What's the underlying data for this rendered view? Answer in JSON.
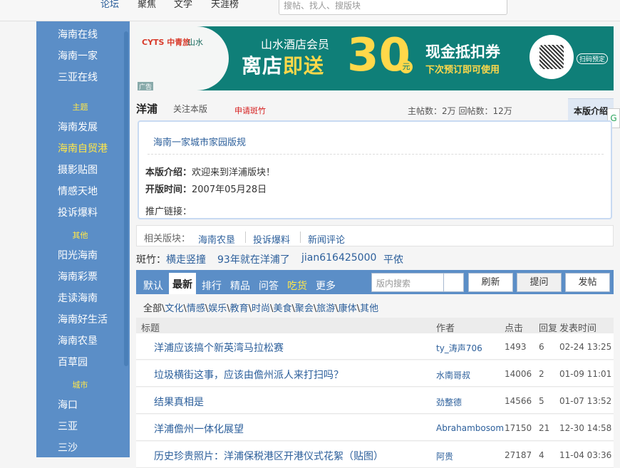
{
  "topnav": [
    "论坛",
    "聚焦",
    "文学",
    "天涯榜"
  ],
  "search_top_placeholder": "搜帖、找人、搜版块",
  "sidebar": {
    "items_top": [
      "海南在线",
      "海南一家",
      "三亚在线"
    ],
    "head_theme": "主题",
    "items_theme": [
      "海南发展",
      "海南自贸港",
      "摄影贴图",
      "情感天地",
      "投诉爆料"
    ],
    "head_other": "其他",
    "items_other": [
      "阳光海南",
      "海南彩票",
      "走读海南",
      "海南好生活",
      "海南农垦",
      "百草园"
    ],
    "head_city": "城市",
    "items_city": [
      "海口",
      "三亚",
      "三沙"
    ]
  },
  "banner": {
    "logo1": "CYTS 中青旅",
    "logo2": "山水",
    "line1": "山水酒店会员",
    "line2a": "离店",
    "line2b": "即送",
    "amount": "30",
    "yuan": "元",
    "line3": "现金抵扣券",
    "line4": "下次预订即可使用",
    "scan": "扫码预定",
    "ad": "广告"
  },
  "board": {
    "title": "洋浦",
    "follow": "关注本版",
    "apply": "申请斑竹",
    "stats": "主帖数：2万 回帖数：12万",
    "intro_tab": "本版介绍",
    "side_chip": "G",
    "home_link": "海南一家城市家园版规",
    "intro_label": "本版介绍：",
    "intro_value": "欢迎来到洋浦版块！",
    "open_label": "开版时间：",
    "open_value": "2007年05月28日",
    "promo_label": "推广链接："
  },
  "related": {
    "label": "相关版块：",
    "items": [
      "海南农垦",
      "投诉爆料",
      "新闻评论"
    ]
  },
  "moderators": {
    "label": "斑竹：",
    "names": [
      "横走竖撞",
      "93年就在洋浦了",
      "jian616425000",
      "平侬"
    ]
  },
  "tabs": [
    "默认",
    "最新",
    "排行",
    "精品",
    "问答",
    "吃货",
    "更多"
  ],
  "board_search_placeholder": "版内搜索",
  "buttons": [
    "刷新",
    "提问",
    "发帖"
  ],
  "categories": {
    "all": "全部",
    "items": [
      "文化",
      "情感",
      "娱乐",
      "教育",
      "时尚",
      "美食",
      "聚会",
      "旅游",
      "康体",
      "其他"
    ]
  },
  "table": {
    "headers": [
      "标题",
      "作者",
      "点击",
      "回复",
      "发表时间"
    ],
    "rows": [
      {
        "title": "洋浦应该搞个新英湾马拉松赛",
        "author": "ty_涛声706",
        "views": "1493",
        "replies": "6",
        "date": "02-24 13:25"
      },
      {
        "title": "垃圾横街这事，应该由儋州派人来打扫吗？",
        "author": "水南哥叔",
        "views": "14006",
        "replies": "2",
        "date": "01-09 11:01"
      },
      {
        "title": "结果真相是",
        "author": "劲整德",
        "views": "14566",
        "replies": "5",
        "date": "01-07 13:52"
      },
      {
        "title": "洋浦儋州一体化展望",
        "author": "Abrahambosom",
        "views": "17150",
        "replies": "21",
        "date": "12-30 14:58"
      },
      {
        "title": "历史珍贵照片：洋浦保税港区开港仪式花絮（贴图）",
        "author": "阿贵",
        "views": "27187",
        "replies": "4",
        "date": "11-04 03:36"
      }
    ]
  }
}
